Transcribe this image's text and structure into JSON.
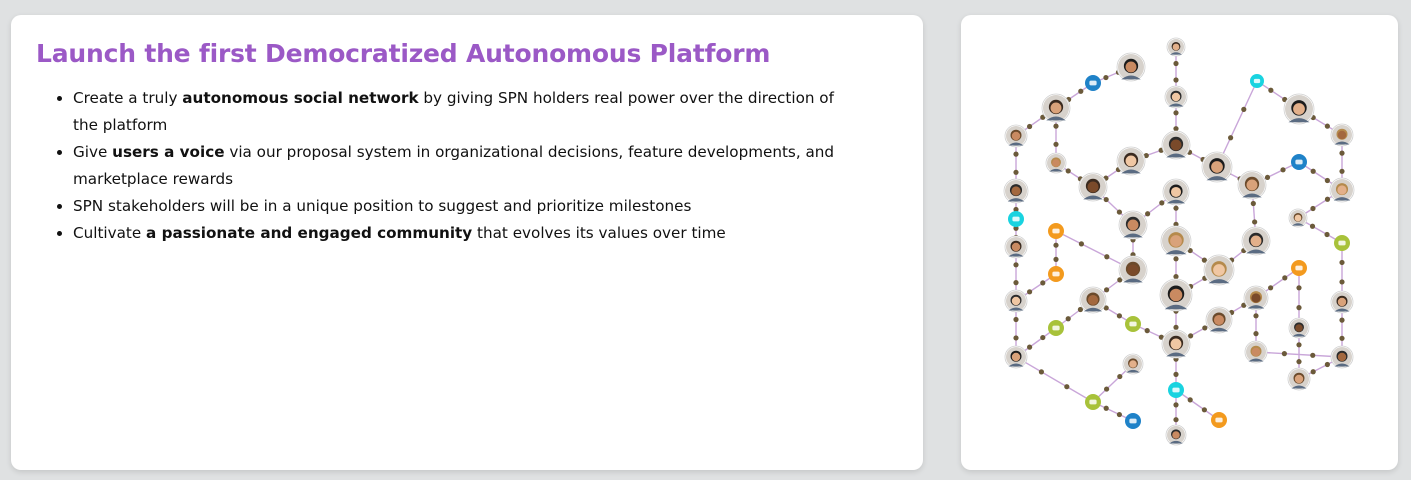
{
  "heading": "Launch the first Democratized Autonomous Platform",
  "bullets": [
    {
      "pre": "Create a truly ",
      "bold": "autonomous social network",
      "post": " by giving SPN holders real power over the direction of the platform"
    },
    {
      "pre": "Give ",
      "bold": "users a voice",
      "post": " via our proposal system in organizational decisions, feature developments, and marketplace rewards"
    },
    {
      "pre": "SPN stakeholders will be in a unique position to suggest and prioritize milestones",
      "bold": "",
      "post": ""
    },
    {
      "pre": "Cultivate ",
      "bold": "a passionate and engaged community",
      "post": " that evolves its values over time"
    }
  ],
  "colors": {
    "accent": "#9b59c6",
    "link_line": "#c9a6d9",
    "connector": "#6b5a3a",
    "badge_cyan": "#19d3e0",
    "badge_orange": "#f39a1e",
    "badge_green": "#a8c23a",
    "badge_blue": "#1f82c8"
  },
  "illustration": {
    "icon": "community-network-illustration"
  }
}
